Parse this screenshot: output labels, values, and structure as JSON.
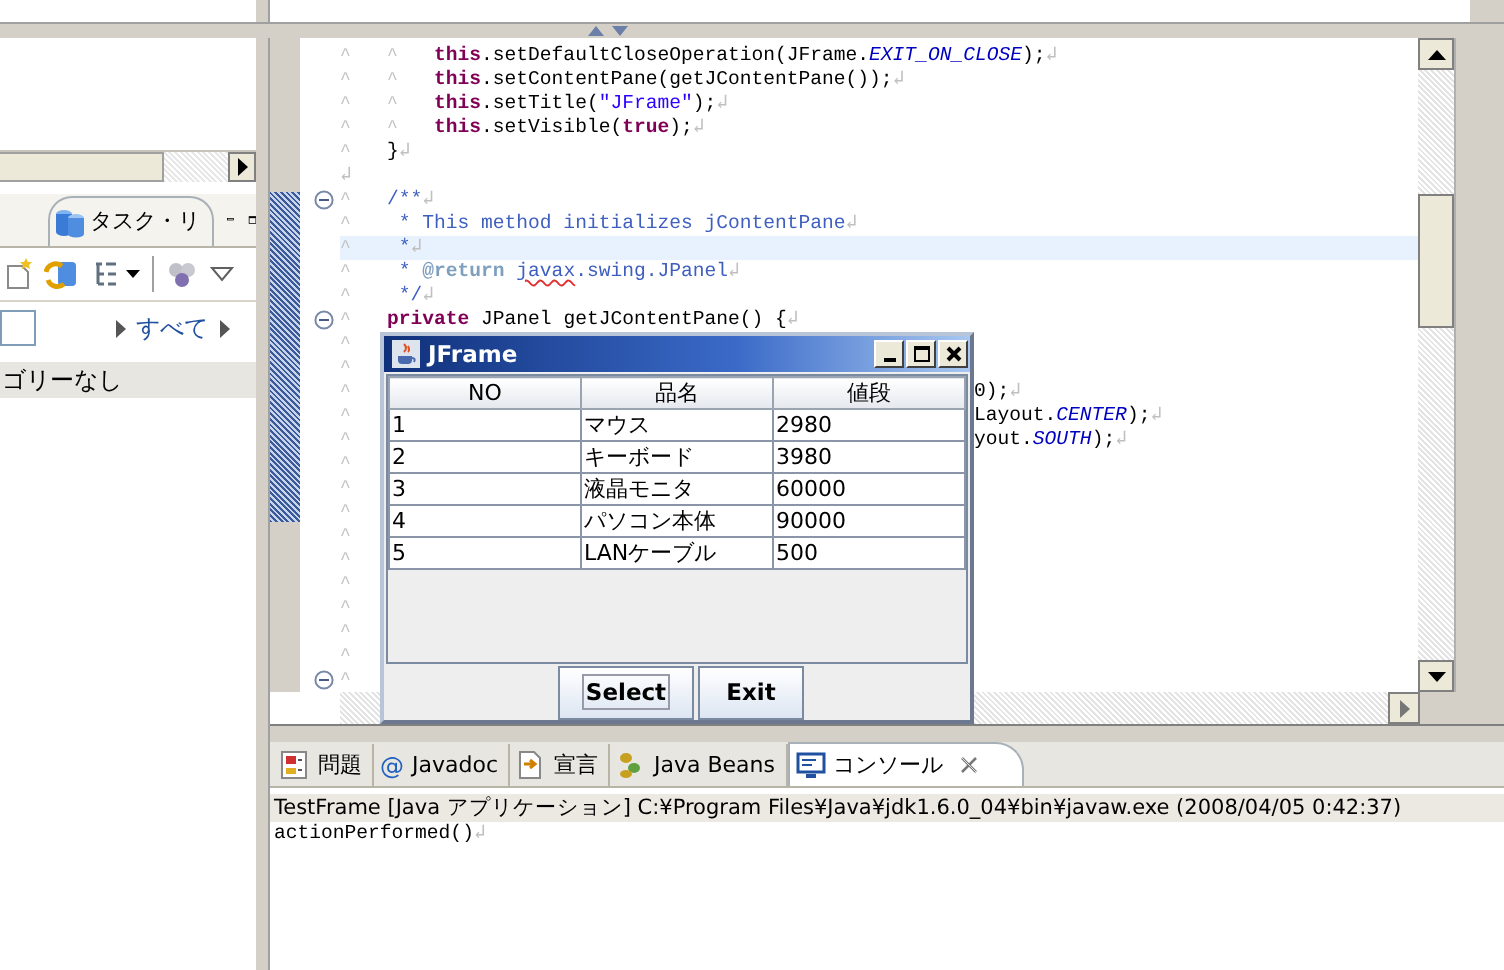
{
  "left_panel": {
    "tabs": [
      {
        "label": "タスク・リ",
        "selected": false
      }
    ],
    "filter_link": "すべて",
    "rows": [
      "ゴリーなし"
    ]
  },
  "editor": {
    "lines": [
      {
        "fold": false,
        "highlighted": false,
        "segments": [
          {
            "kind": "tab",
            "text": "^"
          },
          {
            "kind": "tab",
            "text": "^"
          },
          {
            "kind": "keyword",
            "text": "this"
          },
          {
            "kind": "plain",
            "text": ".setDefaultCloseOperation(JFrame."
          },
          {
            "kind": "constant",
            "text": "EXIT_ON_CLOSE"
          },
          {
            "kind": "plain",
            "text": ");"
          },
          {
            "kind": "eol",
            "text": "↲"
          }
        ]
      },
      {
        "fold": false,
        "highlighted": false,
        "segments": [
          {
            "kind": "tab",
            "text": "^"
          },
          {
            "kind": "tab",
            "text": "^"
          },
          {
            "kind": "keyword",
            "text": "this"
          },
          {
            "kind": "plain",
            "text": ".setContentPane(getJContentPane());"
          },
          {
            "kind": "eol",
            "text": "↲"
          }
        ]
      },
      {
        "fold": false,
        "highlighted": false,
        "segments": [
          {
            "kind": "tab",
            "text": "^"
          },
          {
            "kind": "tab",
            "text": "^"
          },
          {
            "kind": "keyword",
            "text": "this"
          },
          {
            "kind": "plain",
            "text": ".setTitle("
          },
          {
            "kind": "string",
            "text": "\"JFrame\""
          },
          {
            "kind": "plain",
            "text": ");"
          },
          {
            "kind": "eol",
            "text": "↲"
          }
        ]
      },
      {
        "fold": false,
        "highlighted": false,
        "segments": [
          {
            "kind": "tab",
            "text": "^"
          },
          {
            "kind": "tab",
            "text": "^"
          },
          {
            "kind": "keyword",
            "text": "this"
          },
          {
            "kind": "plain",
            "text": ".setVisible("
          },
          {
            "kind": "keyword",
            "text": "true"
          },
          {
            "kind": "plain",
            "text": ");"
          },
          {
            "kind": "eol",
            "text": "↲"
          }
        ]
      },
      {
        "fold": false,
        "highlighted": false,
        "segments": [
          {
            "kind": "tab",
            "text": "^"
          },
          {
            "kind": "plain",
            "text": "}"
          },
          {
            "kind": "eol",
            "text": "↲"
          }
        ]
      },
      {
        "fold": false,
        "highlighted": false,
        "segments": [
          {
            "kind": "eol",
            "text": "↲"
          }
        ]
      },
      {
        "fold": true,
        "highlighted": false,
        "segments": [
          {
            "kind": "tab",
            "text": "^"
          },
          {
            "kind": "comment",
            "text": "/**"
          },
          {
            "kind": "eol",
            "text": "↲"
          }
        ]
      },
      {
        "fold": false,
        "highlighted": false,
        "segments": [
          {
            "kind": "tab",
            "text": "^"
          },
          {
            "kind": "comment",
            "text": " * This method initializes jContentPane"
          },
          {
            "kind": "eol",
            "text": "↲"
          }
        ]
      },
      {
        "fold": false,
        "highlighted": true,
        "segments": [
          {
            "kind": "tab",
            "text": "^"
          },
          {
            "kind": "comment",
            "text": " *"
          },
          {
            "kind": "eol",
            "text": "↲"
          }
        ]
      },
      {
        "fold": false,
        "highlighted": false,
        "segments": [
          {
            "kind": "tab",
            "text": "^"
          },
          {
            "kind": "comment",
            "text": " * "
          },
          {
            "kind": "tag",
            "text": "@return"
          },
          {
            "kind": "misspelled",
            "text": "javax"
          },
          {
            "kind": "comment",
            "text": ".swing.JPanel"
          },
          {
            "kind": "eol",
            "text": "↲"
          }
        ]
      },
      {
        "fold": false,
        "highlighted": false,
        "segments": [
          {
            "kind": "tab",
            "text": "^"
          },
          {
            "kind": "comment",
            "text": " */"
          },
          {
            "kind": "eol",
            "text": "↲"
          }
        ]
      },
      {
        "fold": true,
        "highlighted": false,
        "segments": [
          {
            "kind": "tab",
            "text": "^"
          },
          {
            "kind": "keyword",
            "text": "private"
          },
          {
            "kind": "plain",
            "text": " JPanel getJContentPane() {"
          },
          {
            "kind": "eol",
            "text": "↲"
          }
        ]
      },
      {
        "fold": false,
        "highlighted": false,
        "segments": [
          {
            "kind": "tab",
            "text": "^"
          }
        ]
      },
      {
        "fold": false,
        "highlighted": false,
        "segments": [
          {
            "kind": "tab",
            "text": "^"
          }
        ]
      },
      {
        "fold": false,
        "highlighted": false,
        "segments": [
          {
            "kind": "tab",
            "text": "^"
          }
        ],
        "tail": [
          {
            "kind": "plain",
            "text": "0);"
          },
          {
            "kind": "eol",
            "text": "↲"
          }
        ]
      },
      {
        "fold": false,
        "highlighted": false,
        "segments": [
          {
            "kind": "tab",
            "text": "^"
          }
        ],
        "tail": [
          {
            "kind": "plain",
            "text": "Layout."
          },
          {
            "kind": "constant",
            "text": "CENTER"
          },
          {
            "kind": "plain",
            "text": ");"
          },
          {
            "kind": "eol",
            "text": "↲"
          }
        ]
      },
      {
        "fold": false,
        "highlighted": false,
        "segments": [
          {
            "kind": "tab",
            "text": "^"
          }
        ],
        "tail": [
          {
            "kind": "plain",
            "text": "yout."
          },
          {
            "kind": "constant",
            "text": "SOUTH"
          },
          {
            "kind": "plain",
            "text": ");"
          },
          {
            "kind": "eol",
            "text": "↲"
          }
        ]
      },
      {
        "fold": false,
        "highlighted": false,
        "segments": [
          {
            "kind": "tab",
            "text": "^"
          }
        ]
      },
      {
        "fold": false,
        "highlighted": false,
        "segments": [
          {
            "kind": "tab",
            "text": "^"
          }
        ]
      },
      {
        "fold": false,
        "highlighted": false,
        "segments": [
          {
            "kind": "tab",
            "text": "^"
          }
        ]
      },
      {
        "fold": false,
        "highlighted": false,
        "segments": [
          {
            "kind": "tab",
            "text": "^"
          }
        ]
      },
      {
        "fold": false,
        "highlighted": false,
        "segments": [
          {
            "kind": "tab",
            "text": "^"
          }
        ]
      },
      {
        "fold": false,
        "highlighted": false,
        "segments": [
          {
            "kind": "tab",
            "text": "^"
          }
        ]
      },
      {
        "fold": false,
        "highlighted": false,
        "segments": [
          {
            "kind": "tab",
            "text": "^"
          }
        ]
      },
      {
        "fold": false,
        "highlighted": false,
        "segments": [
          {
            "kind": "tab",
            "text": "^"
          }
        ]
      },
      {
        "fold": false,
        "highlighted": false,
        "segments": [
          {
            "kind": "tab",
            "text": "^"
          }
        ]
      },
      {
        "fold": true,
        "highlighted": false,
        "segments": [
          {
            "kind": "tab",
            "text": "^"
          }
        ]
      }
    ]
  },
  "jframe": {
    "title": "JFrame",
    "table": {
      "columns": [
        "NO",
        "品名",
        "値段"
      ],
      "rows": [
        [
          "1",
          "マウス",
          "2980"
        ],
        [
          "2",
          "キーボード",
          "3980"
        ],
        [
          "3",
          "液晶モニタ",
          "60000"
        ],
        [
          "4",
          "パソコン本体",
          "90000"
        ],
        [
          "5",
          "LANケーブル",
          "500"
        ]
      ]
    },
    "buttons": [
      {
        "label": "Select",
        "focused": true
      },
      {
        "label": "Exit",
        "focused": false
      }
    ]
  },
  "bottom_panel": {
    "tabs": [
      {
        "kind": "problems",
        "label": "問題",
        "selected": false
      },
      {
        "kind": "javadoc",
        "glyph": "@",
        "label": "Javadoc",
        "selected": false
      },
      {
        "kind": "declaration",
        "label": "宣言",
        "selected": false
      },
      {
        "kind": "beans",
        "label": "Java Beans",
        "selected": false
      },
      {
        "kind": "console",
        "label": "コンソール",
        "selected": true
      }
    ],
    "console_header": "TestFrame [Java アプリケーション] C:¥Program Files¥Java¥jdk1.6.0_04¥bin¥javaw.exe (2008/04/05 0:42:37)",
    "output": [
      {
        "text": "actionPerformed()",
        "eol": "↲"
      }
    ]
  }
}
